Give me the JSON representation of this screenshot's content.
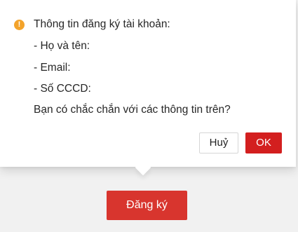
{
  "dialog": {
    "icon": "warning-icon",
    "icon_color": "#f3a32b",
    "title": "Thông tin đăng ký tài khoản:",
    "fields": [
      "- Họ và tên:",
      "- Email:",
      "- Số CCCD:"
    ],
    "question": "Bạn có chắc chắn với các thông tin trên?",
    "cancel_label": "Huỷ",
    "ok_label": "OK",
    "ok_color": "#d31f1f"
  },
  "page": {
    "register_label": "Đăng ký",
    "register_color": "#d8352e"
  }
}
